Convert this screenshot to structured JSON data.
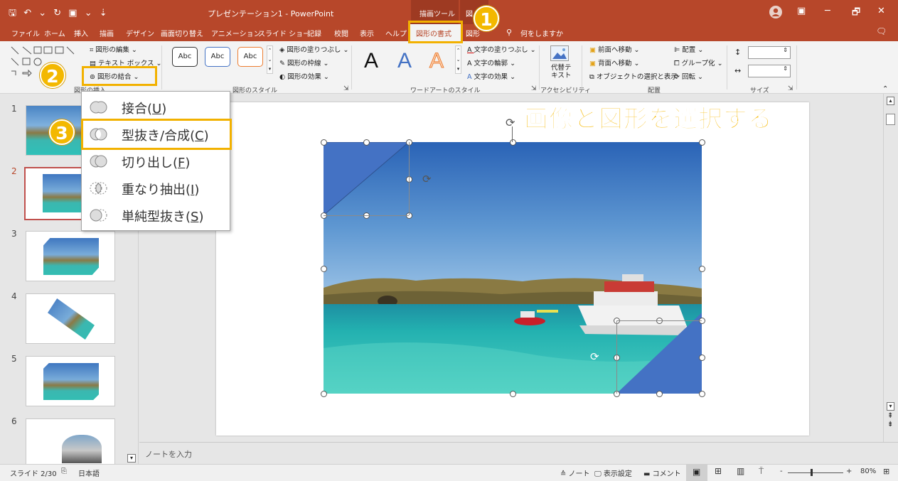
{
  "titlebar": {
    "qat": "🖫 ↶ ⌄ ↻ ▣ ⌄ ⇣",
    "document_title": "プレゼンテーション1 - PowerPoint",
    "tool_context": "描画ツール",
    "tool_context_partial": "図",
    "win_ribbon_icon": "▣",
    "win_minimize": "─",
    "win_restore": "🗗",
    "win_close": "✕"
  },
  "tabs": {
    "items": [
      "ファイル",
      "ホーム",
      "挿入",
      "描画",
      "デザイン",
      "画面切り替え",
      "アニメーション",
      "スライド ショー",
      "記録",
      "校閲",
      "表示",
      "ヘルプ"
    ],
    "active": "図形の書式",
    "extra": "図形",
    "tellme": "何をしますか",
    "comment_icon": "🗨"
  },
  "ribbon": {
    "insert_shapes": {
      "edit_shape": "図形の編集",
      "edit_shape_arrow": "⌄",
      "text_box": "テキスト ボックス",
      "text_box_arrow": "⌄",
      "merge_shapes": "図形の結合",
      "merge_shapes_arrow": "⌄",
      "group_label": "図形の挿入"
    },
    "shape_styles": {
      "samples": [
        "Abc",
        "Abc",
        "Abc"
      ],
      "fill": "図形の塗りつぶし",
      "fill_arrow": "⌄",
      "outline": "図形の枠線",
      "outline_arrow": "⌄",
      "effects": "図形の効果",
      "effects_arrow": "⌄",
      "group_label": "図形のスタイル",
      "launcher": "⇲"
    },
    "wordart": {
      "letters": [
        "A",
        "A",
        "A"
      ],
      "text_fill": "文字の塗りつぶし",
      "text_fill_arrow": "⌄",
      "text_outline": "文字の輪郭",
      "text_outline_arrow": "⌄",
      "text_effects": "文字の効果",
      "text_effects_arrow": "⌄",
      "group_label": "ワードアートのスタイル",
      "launcher": "⇲"
    },
    "accessibility": {
      "alt_text": "代替テ\nキスト",
      "group_label": "アクセシビリティ"
    },
    "arrange": {
      "bring_forward": "前面へ移動",
      "bring_forward_arrow": "⌄",
      "send_backward": "背面へ移動",
      "send_backward_arrow": "⌄",
      "selection_pane": "オブジェクトの選択と表示",
      "align": "配置",
      "align_arrow": "⌄",
      "group": "グループ化",
      "group_arrow": "⌄",
      "rotate": "回転",
      "rotate_arrow": "⌄",
      "group_label": "配置"
    },
    "size": {
      "height": "",
      "width": "",
      "group_label": "サイズ",
      "launcher": "⇲"
    },
    "collapse": "⌃"
  },
  "badges": {
    "b1": "1",
    "b2": "2",
    "b3": "3"
  },
  "merge_menu": {
    "items": [
      {
        "label": "接合(",
        "key": "U",
        "suffix": ")"
      },
      {
        "label": "型抜き/合成(",
        "key": "C",
        "suffix": ")"
      },
      {
        "label": "切り出し(",
        "key": "F",
        "suffix": ")"
      },
      {
        "label": "重なり抽出(",
        "key": "I",
        "suffix": ")"
      },
      {
        "label": "単純型抜き(",
        "key": "S",
        "suffix": ")"
      }
    ]
  },
  "thumbnails": {
    "numbers": [
      "1",
      "2",
      "3",
      "4",
      "5",
      "6"
    ],
    "scroll_down": "▾"
  },
  "caption": "画像と図形を選択する",
  "notes": {
    "placeholder": "ノートを入力"
  },
  "scrollbar": {
    "up": "▴",
    "down": "▾",
    "prev_slide": "⇞",
    "next_slide": "⇟"
  },
  "statusbar": {
    "slide": "スライド 2/30",
    "language": "日本語",
    "notes": "≙ ノート",
    "display_settings": "表示設定",
    "comments": "コメント",
    "zoom_minus": "-",
    "zoom_plus": "+",
    "zoom": "80%",
    "fit": "⊞"
  },
  "colors": {
    "accent": "#b7472a",
    "highlight": "#f2b100",
    "shape_blue": "#4472c4"
  }
}
